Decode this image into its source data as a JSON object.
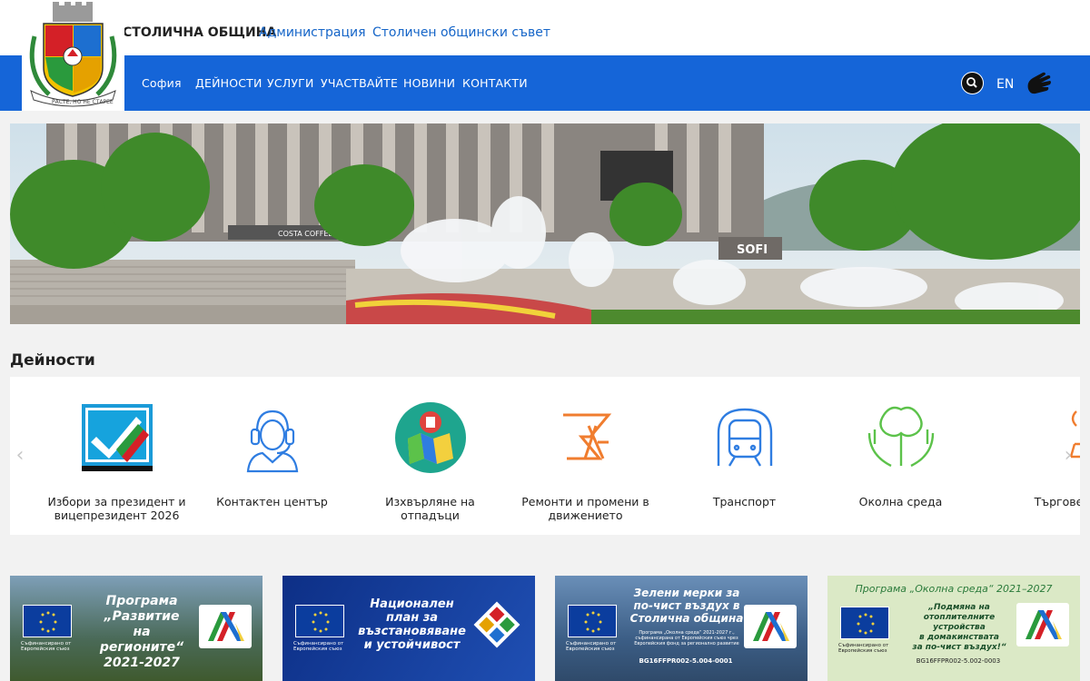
{
  "header": {
    "site_name": "СТОЛИЧНА ОБЩИНА",
    "links": [
      "Администрация",
      "Столичен общински съвет"
    ],
    "crest_motto": "РАСТЕ, НО НЕ СТАРЕЕ"
  },
  "nav": {
    "items": [
      "София",
      "ДЕЙНОСТИ",
      "УСЛУГИ",
      "УЧАСТВАЙТЕ",
      "НОВИНИ",
      "КОНТАКТИ"
    ],
    "lang": "EN",
    "search_icon": "search-icon",
    "sign_language_icon": "sign-language-icon"
  },
  "hero": {
    "sign_1": "COSTA COFFEE",
    "sign_2": "SOFI"
  },
  "activities": {
    "title": "Дейности",
    "items": [
      {
        "label": "Избори за президент и вицепрезидент 2026",
        "icon": "ballot-check-icon"
      },
      {
        "label": "Контактен център",
        "icon": "headset-operator-icon"
      },
      {
        "label": "Изхвърляне на отпадъци",
        "icon": "waste-map-icon"
      },
      {
        "label": "Ремонти и промени в движението",
        "icon": "traffic-cone-icon"
      },
      {
        "label": "Транспорт",
        "icon": "metro-train-icon"
      },
      {
        "label": "Околна среда",
        "icon": "tree-hands-icon"
      },
      {
        "label": "Търгове",
        "icon": "auction-icon"
      }
    ]
  },
  "banners": [
    {
      "title": "Програма „Развитие на регионите“ 2021-2027",
      "line1": "Програма",
      "line2": "„Развитие",
      "line3": "на регионите“",
      "line4": "2021-2027",
      "eu_caption": "Съфинансирано от Европейския съюз"
    },
    {
      "title": "Национален план за възстановяване и устойчивост",
      "line1": "Национален",
      "line2": "план за",
      "line3": "възстановяване",
      "line4": "и устойчивост",
      "eu_caption": "Съфинансирано от Европейския съюз"
    },
    {
      "title": "Зелени мерки за по-чист въздух в Столична община",
      "line1": "Зелени мерки за",
      "line2": "по-чист въздух в",
      "line3": "Столична община",
      "small": "Програма „Околна среда“ 2021-2027 г., съфинансирана от Европейския съюз чрез Европейския фонд за регионално развитие",
      "code": "BG16FFPR002-5.004-0001",
      "eu_caption": "Съфинансирано от Европейския съюз"
    },
    {
      "title": "Програма „Околна среда“ 2021–2027",
      "line1": "„Подмяна на",
      "line2": "отоплителните устройства",
      "line3": "в домакинствата",
      "line4": "за по-чист въздух!“",
      "code": "BG16FFPR002-5.002-0003",
      "eu_caption": "Съфинансирано от Европейския съюз"
    }
  ],
  "colors": {
    "nav_blue": "#1565d8",
    "link_blue": "#1565c8",
    "icon_blue": "#2f7de1",
    "icon_orange": "#f07d2f",
    "icon_green": "#5cc24a",
    "teal": "#1ea58e"
  }
}
